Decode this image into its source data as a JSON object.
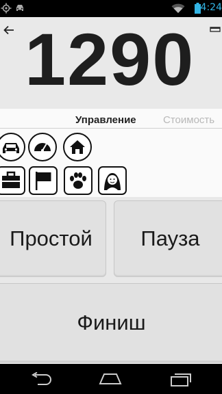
{
  "status_bar": {
    "time": "4:24",
    "icons": [
      "gps-icon",
      "car-notification-icon",
      "wifi-icon",
      "battery-icon"
    ]
  },
  "meter": {
    "amount": "1290"
  },
  "tabs": [
    {
      "label": "Управление",
      "active": true
    },
    {
      "label": "Стоимость",
      "active": false
    }
  ],
  "options": {
    "row1": [
      "car-icon",
      "speedometer-icon",
      "home-icon"
    ],
    "row2": [
      "suitcase-icon",
      "flag-icon",
      "paw-icon",
      "woman-icon"
    ]
  },
  "buttons": {
    "idle": "Простой",
    "pause": "Пауза",
    "finish": "Финиш"
  },
  "nav_bar": [
    "back-nav-icon",
    "home-nav-icon",
    "recent-apps-icon"
  ],
  "colors": {
    "status_time": "#33b5e5",
    "background": "#e8e8e8",
    "button": "#e1e1e1"
  }
}
